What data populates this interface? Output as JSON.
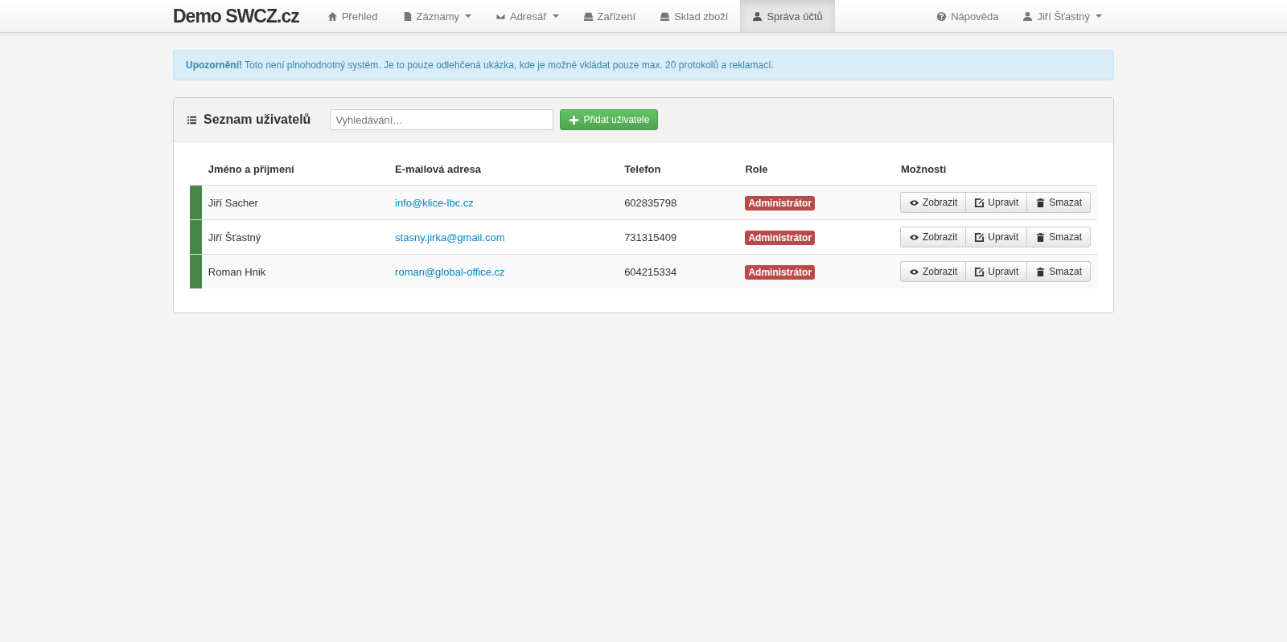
{
  "brand": "Demo SWCZ.cz",
  "nav": [
    {
      "label": "Přehled",
      "kind": "home",
      "dropdown": false,
      "selected": false
    },
    {
      "label": "Záznamy",
      "kind": "file",
      "dropdown": true,
      "selected": false
    },
    {
      "label": "Adresář",
      "kind": "mail",
      "dropdown": true,
      "selected": false
    },
    {
      "label": "Zařízení",
      "kind": "device",
      "dropdown": false,
      "selected": false
    },
    {
      "label": "Sklad zboží",
      "kind": "device",
      "dropdown": false,
      "selected": false
    },
    {
      "label": "Správa účtů",
      "kind": "user",
      "dropdown": false,
      "selected": true
    }
  ],
  "nav_right": [
    {
      "label": "Nápověda",
      "kind": "help",
      "dropdown": false
    },
    {
      "label": "Jiří Šťastný",
      "kind": "user",
      "dropdown": true
    }
  ],
  "alert": "**Upozornění!** Toto není plnohodnotný systém. Je to pouze odlehčená ukázka, kde je možné vkládat pouze max. 20 protokolů a reklamací.",
  "panel": {
    "title": "Seznam uživatelů",
    "search": {
      "placeholder": "Vyhledávání..."
    },
    "add_button": "Přidat uživatele"
  },
  "table": {
    "columns": [
      "Jméno a příjmení",
      "E-mailová adresa",
      "Telefon",
      "Role",
      "Možnosti"
    ],
    "rows": [
      {
        "color": "#47874a",
        "name": "Jiří Sacher",
        "email": "info@klice-lbc.cz",
        "phone": "602835798",
        "role": "Administrátor",
        "actions": [
          {
            "label": "Zobrazit",
            "kind": "view"
          },
          {
            "label": "Upravit",
            "kind": "edit"
          },
          {
            "label": "Smazat",
            "kind": "delete"
          }
        ]
      },
      {
        "color": "#47874a",
        "name": "Jiří Šťastný",
        "email": "stasny.jirka@gmail.com",
        "phone": "731315409",
        "role": "Administrátor",
        "actions": [
          {
            "label": "Zobrazit",
            "kind": "view"
          },
          {
            "label": "Upravit",
            "kind": "edit"
          },
          {
            "label": "Smazat",
            "kind": "delete"
          }
        ]
      },
      {
        "color": "#47874a",
        "name": "Roman Hnik",
        "email": "roman@global-office.cz",
        "phone": "604215334",
        "role": "Administrátor",
        "actions": [
          {
            "label": "Zobrazit",
            "kind": "view"
          },
          {
            "label": "Upravit",
            "kind": "edit"
          },
          {
            "label": "Smazat",
            "kind": "delete"
          }
        ]
      }
    ]
  }
}
